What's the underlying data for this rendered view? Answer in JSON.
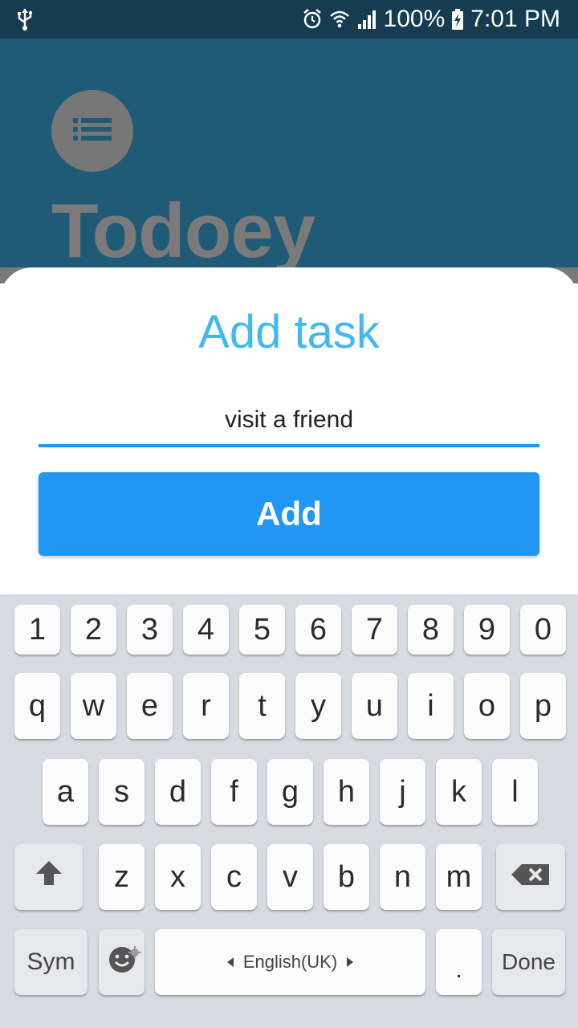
{
  "status_bar": {
    "battery": "100%",
    "time": "7:01 PM",
    "icons": [
      "usb-icon",
      "alarm-icon",
      "wifi-icon",
      "signal-icon",
      "battery-charging-icon"
    ]
  },
  "app": {
    "title": "Todoey",
    "logo_icon": "list-icon"
  },
  "add_task_sheet": {
    "title": "Add task",
    "input_value": "visit a friend",
    "button_label": "Add"
  },
  "keyboard": {
    "number_row": [
      "1",
      "2",
      "3",
      "4",
      "5",
      "6",
      "7",
      "8",
      "9",
      "0"
    ],
    "row1": [
      "q",
      "w",
      "e",
      "r",
      "t",
      "y",
      "u",
      "i",
      "o",
      "p"
    ],
    "row2": [
      "a",
      "s",
      "d",
      "f",
      "g",
      "h",
      "j",
      "k",
      "l"
    ],
    "row3": [
      "z",
      "x",
      "c",
      "v",
      "b",
      "n",
      "m"
    ],
    "sym_label": "Sym",
    "space_label": "English(UK)",
    "period_label": ".",
    "done_label": "Done",
    "icons": [
      "shift-icon",
      "backspace-icon",
      "emoji-icon",
      "settings-gear-icon"
    ]
  },
  "colors": {
    "status_bar": "#153c51",
    "app_background": "#1f5a76",
    "accent_title": "#42b8f2",
    "primary": "#2196f3",
    "keyboard_bg": "#d7dae1"
  }
}
